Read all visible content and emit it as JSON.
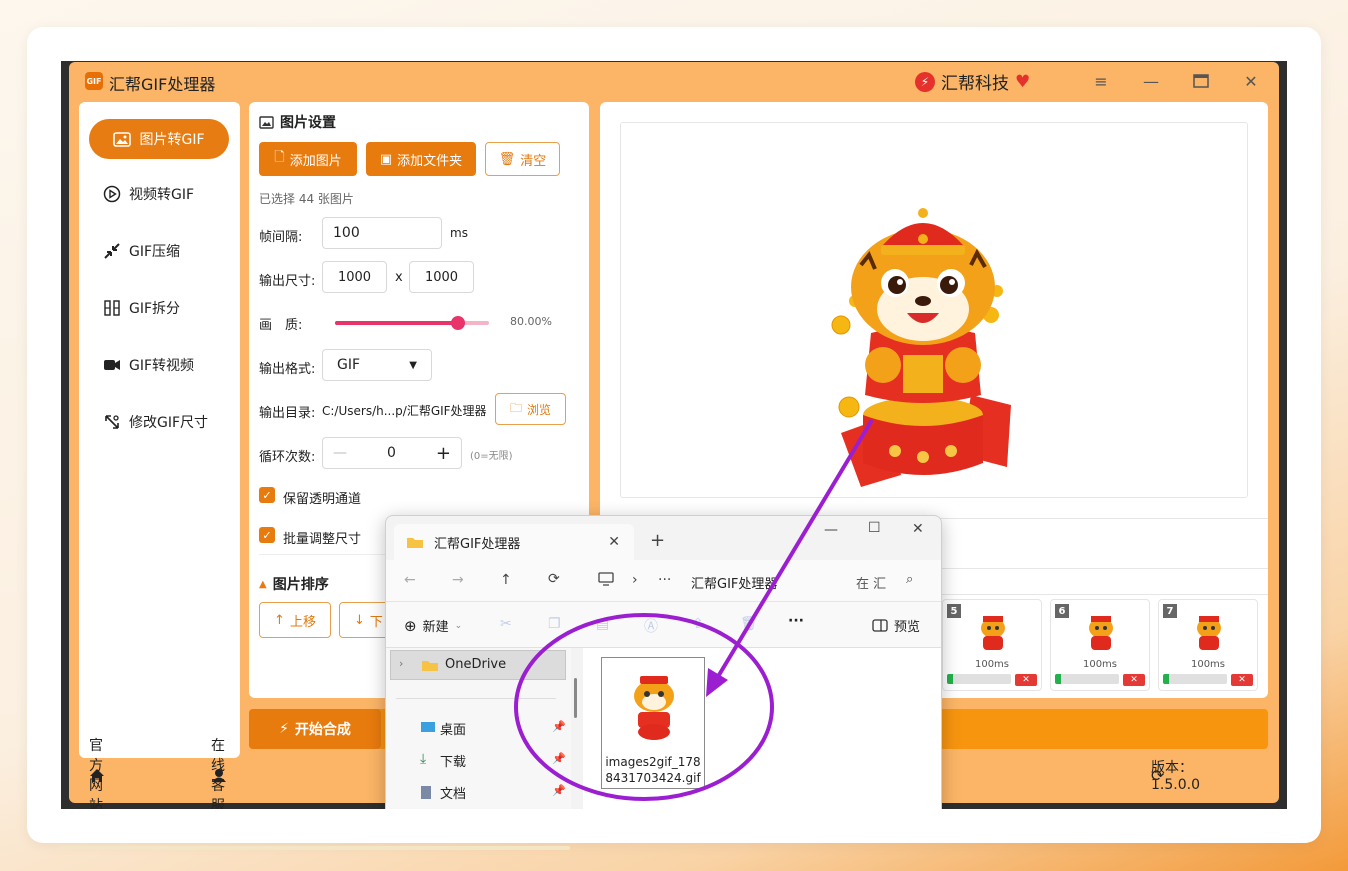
{
  "app": {
    "title": "汇帮GIF处理器",
    "logo_text": "GIF",
    "brand": "汇帮科技",
    "window_controls": [
      "menu-icon",
      "minimize-icon",
      "maximize-icon",
      "close-icon"
    ]
  },
  "nav": {
    "items": [
      {
        "label": "图片转GIF",
        "icon": "image-icon",
        "active": true
      },
      {
        "label": "视频转GIF",
        "icon": "play-icon"
      },
      {
        "label": "GIF压缩",
        "icon": "compress-icon"
      },
      {
        "label": "GIF拆分",
        "icon": "split-icon"
      },
      {
        "label": "GIF转视频",
        "icon": "video-icon"
      },
      {
        "label": "修改GIF尺寸",
        "icon": "resize-icon"
      }
    ]
  },
  "settings": {
    "title": "图片设置",
    "add_image": "添加图片",
    "add_folder": "添加文件夹",
    "clear": "清空",
    "selected": "已选择 44 张图片",
    "frame_interval_label": "帧间隔:",
    "frame_interval_value": "100",
    "frame_interval_unit": "ms",
    "output_size_label": "输出尺寸:",
    "width": "1000",
    "height": "1000",
    "size_sep": "x",
    "quality_label": "画　质:",
    "quality_value": "80.00%",
    "quality_fraction": 0.8,
    "format_label": "输出格式:",
    "format_value": "GIF",
    "output_dir_label": "输出目录:",
    "output_dir_value": "C:/Users/h...p/汇帮GIF处理器",
    "browse": "浏览",
    "loop_label": "循环次数:",
    "loop_value": "0",
    "loop_hint": "(0=无限)",
    "keep_alpha": "保留透明通道",
    "batch_resize": "批量调整尺寸",
    "sort_title": "图片排序",
    "move_up": "上移",
    "move_down_partial": "下"
  },
  "start_button": "开始合成",
  "thumbnails": [
    {
      "index": "5",
      "duration": "100ms"
    },
    {
      "index": "6",
      "duration": "100ms"
    },
    {
      "index": "7",
      "duration": "100ms"
    }
  ],
  "footer": {
    "website": "官方网站",
    "support": "在线客服",
    "version": "版本：1.5.0.0"
  },
  "explorer": {
    "tab_title": "汇帮GIF处理器",
    "breadcrumb_more": "···",
    "breadcrumb_folder": "汇帮GIF处理器",
    "search_placeholder": "在 汇",
    "new_label": "新建",
    "more_label": "···",
    "preview_label": "预览",
    "sidebar": [
      {
        "label": "OneDrive",
        "icon": "folder-icon"
      },
      {
        "label": "桌面",
        "icon": "desktop-icon"
      },
      {
        "label": "下载",
        "icon": "download-icon"
      },
      {
        "label": "文档",
        "icon": "document-icon"
      }
    ],
    "file_name": "images2gif_1788431703424.gif"
  },
  "colors": {
    "accent": "#E87B0E",
    "window_bg": "#FCB566",
    "annotation": "#9B1FD0",
    "slider": "#E8336B"
  }
}
